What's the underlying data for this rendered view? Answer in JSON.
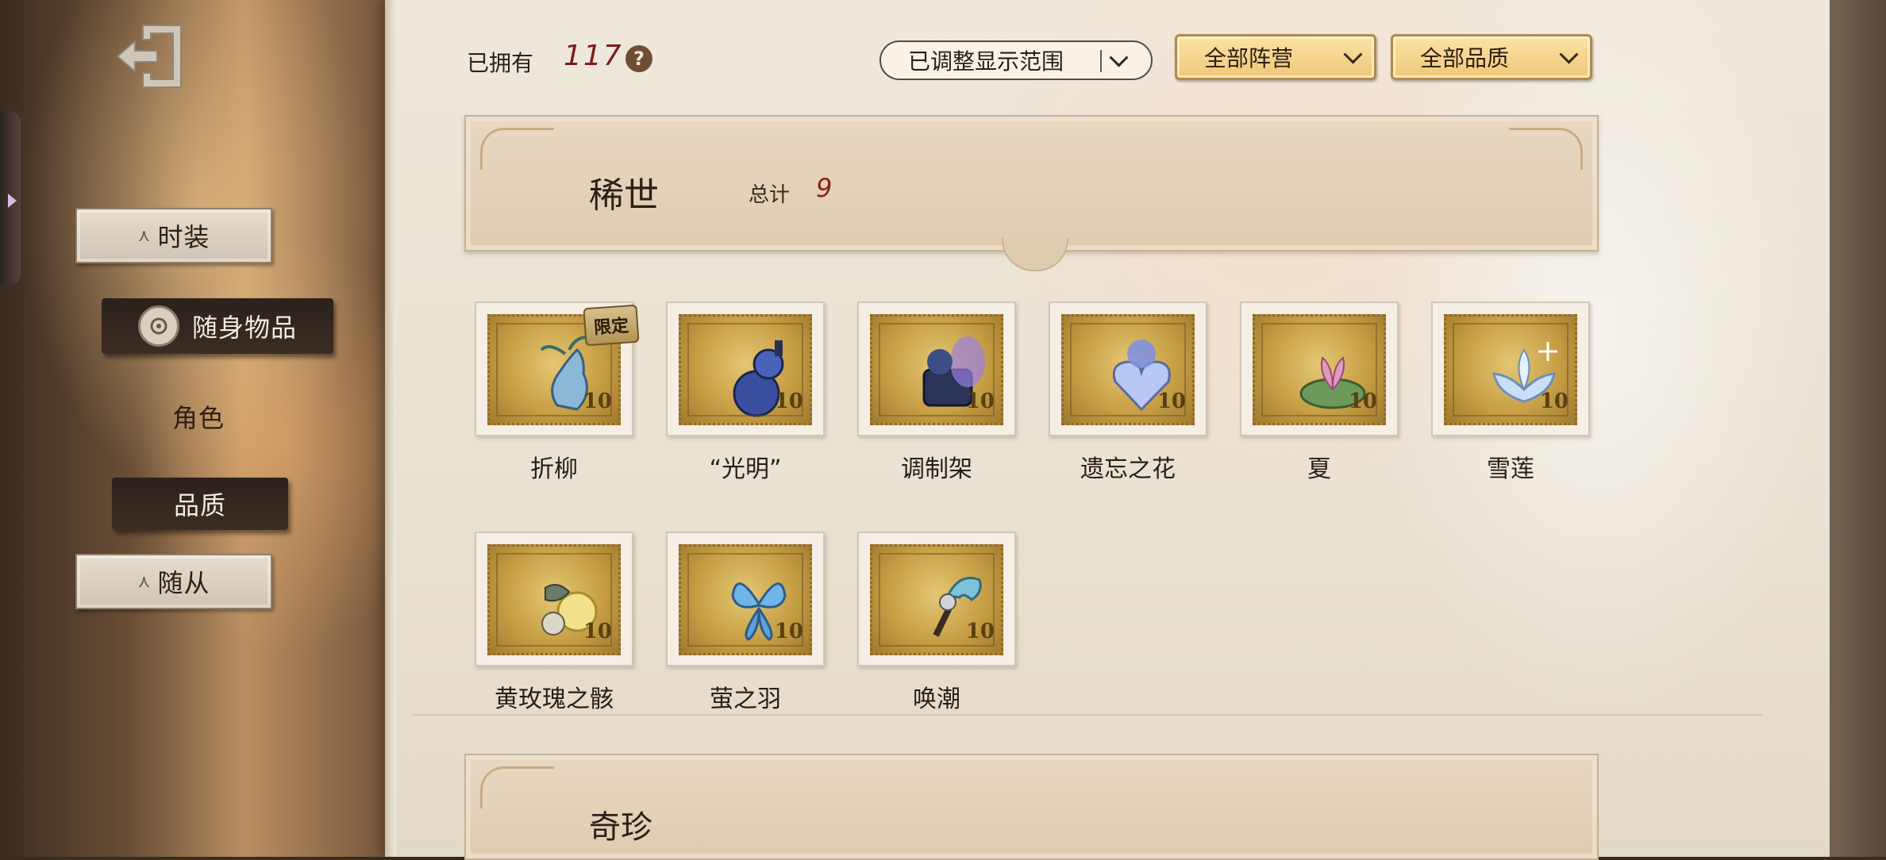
{
  "header": {
    "owned_label": "已拥有",
    "owned_count": "117",
    "help_symbol": "?",
    "filters": {
      "range_label": "已调整显示范围",
      "camp_label": "全部阵营",
      "quality_label": "全部品质"
    }
  },
  "sidebar": {
    "items": [
      {
        "label": "时装",
        "state": "boxed"
      },
      {
        "label": "随身物品",
        "state": "selected"
      },
      {
        "label": "角色",
        "state": "plain"
      },
      {
        "label": "品质",
        "state": "active-dark"
      },
      {
        "label": "随从",
        "state": "boxed"
      }
    ]
  },
  "section": {
    "title": "稀世",
    "total_label": "总计",
    "total_count": "9",
    "next_title": "奇珍"
  },
  "cards": [
    {
      "name": "折柳",
      "limited": true,
      "limited_label": "限定",
      "value": "10",
      "icon": "willow-vase-icon"
    },
    {
      "name": "“光明”",
      "limited": false,
      "value": "10",
      "icon": "gourd-bottle-icon"
    },
    {
      "name": "调制架",
      "limited": false,
      "value": "10",
      "icon": "mixing-rack-icon"
    },
    {
      "name": "遗忘之花",
      "limited": false,
      "value": "10",
      "icon": "crystal-heart-icon"
    },
    {
      "name": "夏",
      "limited": false,
      "value": "10",
      "icon": "lotus-pink-icon"
    },
    {
      "name": "雪莲",
      "limited": false,
      "value": "10",
      "icon": "snow-lotus-icon"
    },
    {
      "name": "黄玫瑰之骸",
      "limited": false,
      "value": "10",
      "icon": "yellow-rose-icon"
    },
    {
      "name": "萤之羽",
      "limited": false,
      "value": "10",
      "icon": "firefly-wing-icon"
    },
    {
      "name": "唤潮",
      "limited": false,
      "value": "10",
      "icon": "tide-caller-icon"
    }
  ],
  "colors": {
    "accent_gold": "#f0c878",
    "count_red": "#7b1e1a",
    "paper": "#efe8dc",
    "nav_dark": "#2b211b"
  }
}
